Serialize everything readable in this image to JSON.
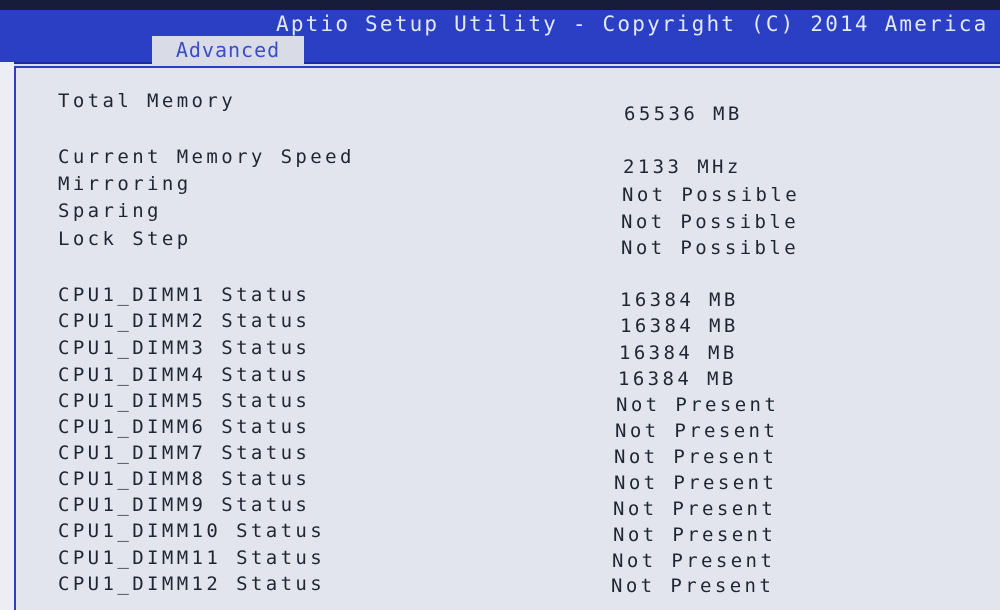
{
  "header": {
    "title": "Aptio Setup Utility - Copyright (C) 2014 America",
    "active_tab": "Advanced"
  },
  "rows": [
    {
      "label": "Total Memory",
      "value": "65536 MB"
    },
    {
      "label": "Current Memory Speed",
      "value": "2133 MHz"
    },
    {
      "label": "Mirroring",
      "value": "Not Possible"
    },
    {
      "label": "Sparing",
      "value": "Not Possible"
    },
    {
      "label": "Lock Step",
      "value": "Not Possible"
    },
    {
      "label": "CPU1_DIMM1 Status",
      "value": "16384 MB"
    },
    {
      "label": "CPU1_DIMM2 Status",
      "value": "16384 MB"
    },
    {
      "label": "CPU1_DIMM3 Status",
      "value": "16384 MB"
    },
    {
      "label": "CPU1_DIMM4 Status",
      "value": "16384 MB"
    },
    {
      "label": "CPU1_DIMM5 Status",
      "value": "Not Present"
    },
    {
      "label": "CPU1_DIMM6 Status",
      "value": "Not Present"
    },
    {
      "label": "CPU1_DIMM7 Status",
      "value": "Not Present"
    },
    {
      "label": "CPU1_DIMM8 Status",
      "value": "Not Present"
    },
    {
      "label": "CPU1_DIMM9 Status",
      "value": "Not Present"
    },
    {
      "label": "CPU1_DIMM10 Status",
      "value": "Not Present"
    },
    {
      "label": "CPU1_DIMM11 Status",
      "value": "Not Present"
    },
    {
      "label": "CPU1_DIMM12 Status",
      "value": "Not Present"
    }
  ]
}
